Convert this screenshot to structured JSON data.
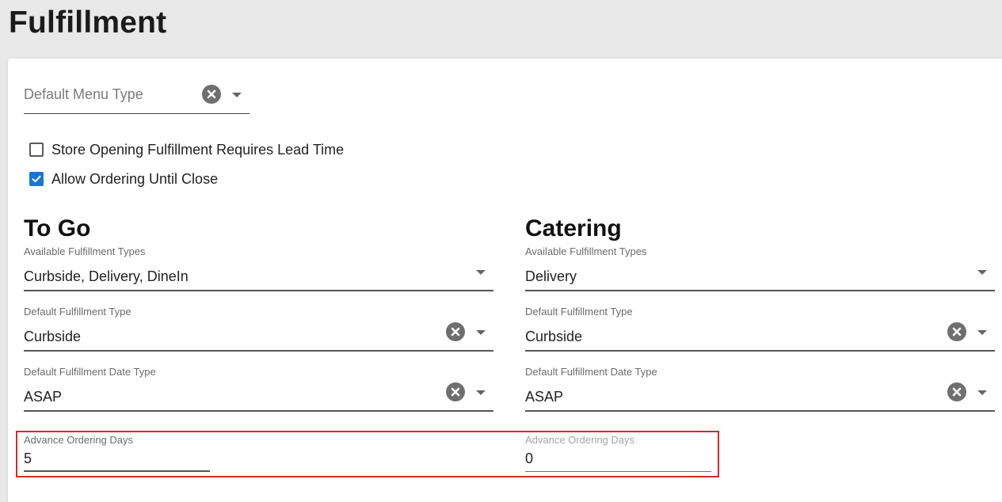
{
  "page": {
    "title": "Fulfillment"
  },
  "default_menu_type": {
    "placeholder": "Default Menu Type"
  },
  "checkboxes": [
    {
      "label": "Store Opening Fulfillment Requires Lead Time",
      "checked": false
    },
    {
      "label": "Allow Ordering Until Close",
      "checked": true
    }
  ],
  "to_go": {
    "title": "To Go",
    "available_types": {
      "label": "Available Fulfillment Types",
      "value": "Curbside, Delivery, DineIn"
    },
    "default_type": {
      "label": "Default Fulfillment Type",
      "value": "Curbside"
    },
    "default_date_type": {
      "label": "Default Fulfillment Date Type",
      "value": "ASAP"
    },
    "advance_days": {
      "label": "Advance Ordering Days",
      "value": "5"
    }
  },
  "catering": {
    "title": "Catering",
    "available_types": {
      "label": "Available Fulfillment Types",
      "value": "Delivery"
    },
    "default_type": {
      "label": "Default Fulfillment Type",
      "value": "Curbside"
    },
    "default_date_type": {
      "label": "Default Fulfillment Date Type",
      "value": "ASAP"
    },
    "advance_days": {
      "label": "Advance Ordering Days",
      "value": "0",
      "disabled": true
    }
  },
  "icons": {
    "clear": "clear-icon",
    "dropdown": "chevron-down-icon",
    "check": "check-icon"
  },
  "colors": {
    "accent": "#1976d2",
    "highlight": "#d62828",
    "icon_gray": "#6f6f6f"
  }
}
